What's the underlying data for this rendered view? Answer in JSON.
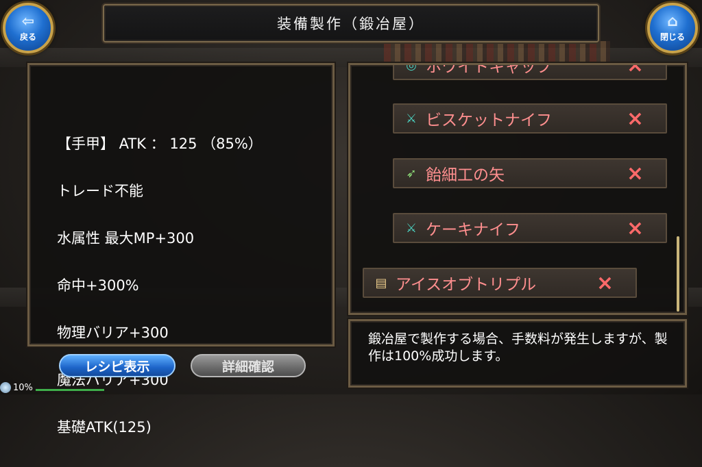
{
  "header": {
    "title": "装備製作（鍛冶屋）"
  },
  "nav": {
    "back_label": "戻る",
    "close_label": "閉じる",
    "back_icon": "back-arrow-icon",
    "close_icon": "home-icon"
  },
  "item_details": {
    "lines": [
      "【手甲】 ATK ： 125 （85%）",
      "トレード不能",
      "水属性 最大MP+300",
      "命中+300%",
      "物理バリア+300",
      "魔法バリア+300",
      "基礎ATK(125)"
    ]
  },
  "recipes": [
    {
      "label": "ホワイトキャップ",
      "icon": "cap-icon",
      "status": "×"
    },
    {
      "label": "ビスケットナイフ",
      "icon": "knife-icon",
      "status": "×"
    },
    {
      "label": "飴細工の矢",
      "icon": "arrow-icon",
      "status": "×"
    },
    {
      "label": "ケーキナイフ",
      "icon": "knife-icon",
      "status": "×"
    },
    {
      "label": "アイスオブトリプル",
      "icon": "scroll-icon",
      "status": "×"
    }
  ],
  "message": {
    "text": "鍛冶屋で製作する場合、手数料が発生しますが、製作は100%成功します。"
  },
  "buttons": {
    "recipe_label": "レシピ表示",
    "detail_label": "詳細確認"
  },
  "status_bar": {
    "percent_label": "10%"
  },
  "colors": {
    "accent_gold": "#c8a24a",
    "recipe_text": "#ff8f8f",
    "primary_button": "#1c64c8"
  }
}
